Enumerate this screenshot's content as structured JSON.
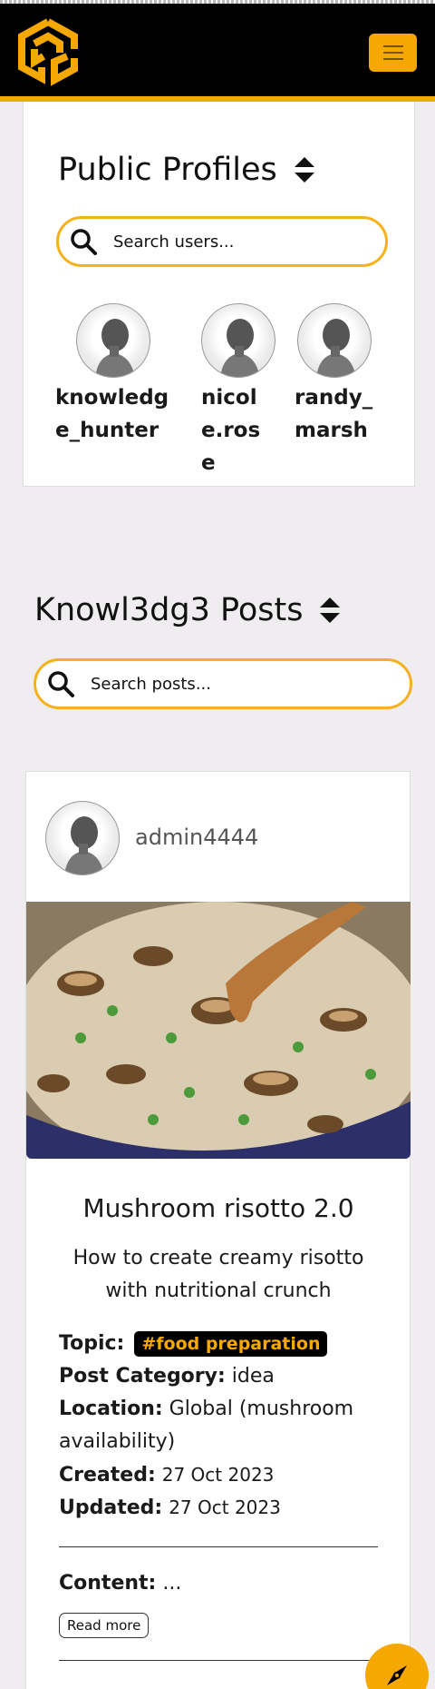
{
  "header": {
    "logo_icon": "cg-cube-logo",
    "menu_icon": "hamburger-icon"
  },
  "profiles": {
    "title": "Public Profiles",
    "search_placeholder": "Search users...",
    "users": [
      {
        "name": "knowledge_hunter"
      },
      {
        "name": "nicole.rose"
      },
      {
        "name": "randy_marsh"
      }
    ]
  },
  "posts": {
    "title": "Knowl3dg3 Posts",
    "search_placeholder": "Search posts...",
    "items": [
      {
        "author": "admin4444",
        "title": "Mushroom risotto 2.0",
        "description": "How to create creamy risotto with nutritional crunch",
        "topic_label": "Topic:",
        "topic": "#food preparation",
        "category_label": "Post Category:",
        "category": "idea",
        "location_label": "Location:",
        "location": "Global (mushroom availability)",
        "created_label": "Created:",
        "created": "27 Oct 2023",
        "updated_label": "Updated:",
        "updated": "27 Oct 2023",
        "content_label": "Content:",
        "content": "...",
        "read_more": "Read more"
      }
    ]
  },
  "colors": {
    "accent": "#f5a800",
    "navbar": "#000000",
    "page_bg": "#efedef"
  },
  "fab": {
    "icon": "compass-icon"
  }
}
